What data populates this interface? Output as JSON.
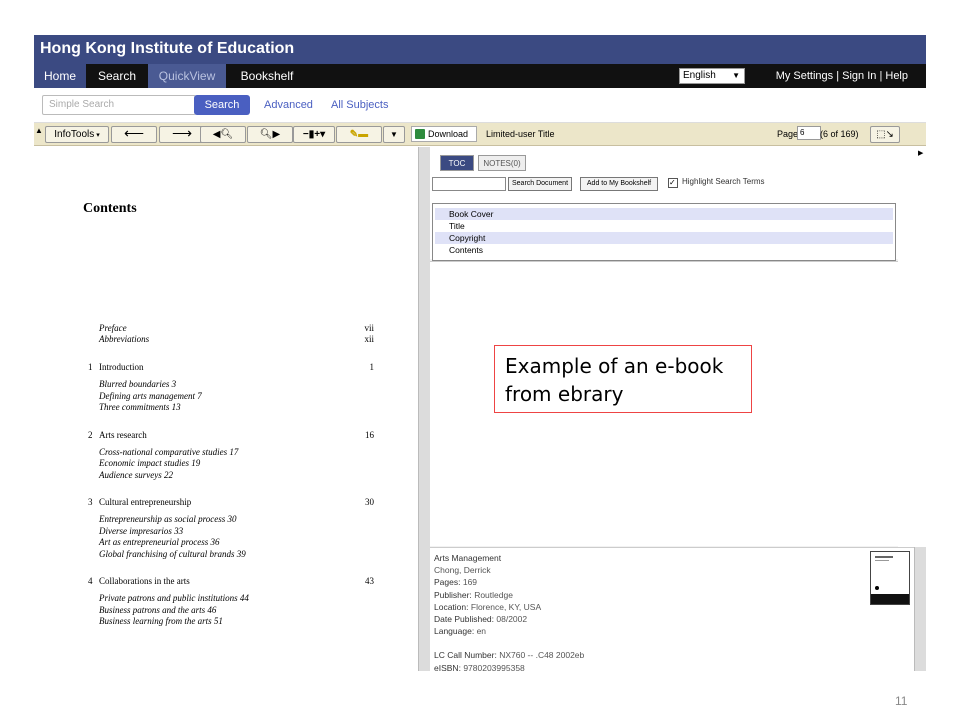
{
  "app": {
    "title": "Hong Kong Institute of Education"
  },
  "nav": {
    "tabs": [
      "Home",
      "Search",
      "QuickView",
      "Bookshelf"
    ],
    "language": "English",
    "links": [
      "My Settings",
      "Sign In",
      "Help"
    ]
  },
  "search": {
    "placeholder": "Simple Search",
    "button": "Search",
    "advanced": "Advanced",
    "all_subjects": "All Subjects"
  },
  "toolbar": {
    "infotools": "InfoTools",
    "download": "Download",
    "title_status": "Limited-user Title",
    "page_label": "Page",
    "page_value": "6",
    "page_of": "(6 of 169)"
  },
  "toc_panel": {
    "tabs": [
      "TOC",
      "NOTES(0)"
    ],
    "search_button": "Search Document",
    "add_button": "Add to My Bookshelf",
    "highlight_label": "Highlight Search Terms",
    "items": [
      "Book Cover",
      "Title",
      "Copyright",
      "Contents"
    ]
  },
  "book_info": {
    "title": "Arts Management",
    "author": "Chong, Derrick",
    "pages_label": "Pages:",
    "pages": "169",
    "publisher_label": "Publisher:",
    "publisher": "Routledge",
    "location_label": "Location:",
    "location": "Florence, KY, USA",
    "date_label": "Date Published:",
    "date": "08/2002",
    "language_label": "Language:",
    "language": "en",
    "lc_label": "LC Call Number:",
    "lc": "NX760 -- .C48 2002eb",
    "isbn_label": "eISBN:",
    "isbn": "9780203995358"
  },
  "page": {
    "heading": "Contents",
    "front": [
      {
        "text": "Preface",
        "page": "vii"
      },
      {
        "text": "Abbreviations",
        "page": "xii"
      }
    ],
    "chapters": [
      {
        "num": "1",
        "title": "Introduction",
        "page": "1",
        "sections": [
          "Blurred boundaries  3",
          "Defining arts management  7",
          "Three commitments  13"
        ]
      },
      {
        "num": "2",
        "title": "Arts research",
        "page": "16",
        "sections": [
          "Cross-national comparative studies  17",
          "Economic impact studies  19",
          "Audience surveys  22"
        ]
      },
      {
        "num": "3",
        "title": "Cultural entrepreneurship",
        "page": "30",
        "sections": [
          "Entrepreneurship as social process  30",
          "Diverse impresarios  33",
          "Art as entrepreneurial process  36",
          "Global franchising of cultural brands  39"
        ]
      },
      {
        "num": "4",
        "title": "Collaborations in the arts",
        "page": "43",
        "sections": [
          "Private patrons and public institutions  44",
          "Business patrons and the arts  46",
          "Business learning from the arts  51"
        ]
      }
    ]
  },
  "callout": {
    "line1": "Example of an e-book",
    "line2": "from ebrary"
  },
  "slide_number": "11"
}
